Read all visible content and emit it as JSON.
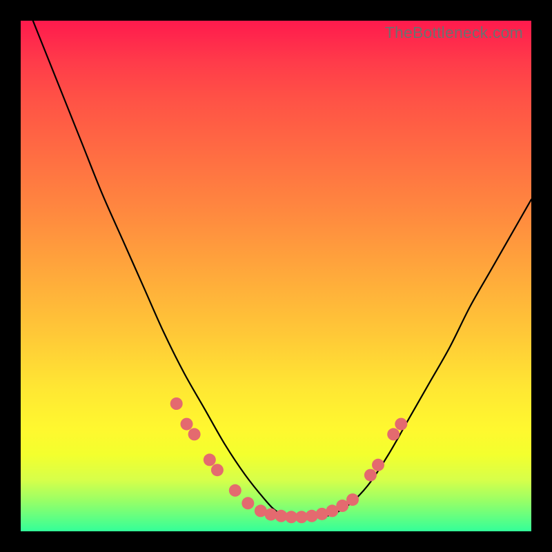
{
  "watermark": "TheBottleneck.com",
  "colors": {
    "dot": "#e46a6f",
    "curve": "#000000",
    "gradient_top": "#ff1a4d",
    "gradient_bottom": "#33ff99",
    "frame": "#000000"
  },
  "chart_data": {
    "type": "line",
    "title": "",
    "xlabel": "",
    "ylabel": "",
    "xlim": [
      0,
      100
    ],
    "ylim": [
      0,
      100
    ],
    "series": [
      {
        "name": "bottleneck-curve",
        "x": [
          0,
          4,
          8,
          12,
          16,
          20,
          24,
          28,
          32,
          36,
          40,
          44,
          48,
          50,
          52,
          56,
          60,
          64,
          68,
          72,
          76,
          80,
          84,
          88,
          92,
          96,
          100
        ],
        "y": [
          106,
          96,
          86,
          76,
          66,
          57,
          48,
          39,
          31,
          24,
          17,
          11,
          6,
          4,
          3,
          3,
          3,
          5,
          9,
          15,
          22,
          29,
          36,
          44,
          51,
          58,
          65
        ]
      }
    ],
    "markers": [
      {
        "x": 30.5,
        "y": 25.0
      },
      {
        "x": 32.5,
        "y": 21.0
      },
      {
        "x": 34.0,
        "y": 19.0
      },
      {
        "x": 37.0,
        "y": 14.0
      },
      {
        "x": 38.5,
        "y": 12.0
      },
      {
        "x": 42.0,
        "y": 8.0
      },
      {
        "x": 44.5,
        "y": 5.5
      },
      {
        "x": 47.0,
        "y": 4.0
      },
      {
        "x": 49.0,
        "y": 3.3
      },
      {
        "x": 51.0,
        "y": 3.0
      },
      {
        "x": 53.0,
        "y": 2.8
      },
      {
        "x": 55.0,
        "y": 2.8
      },
      {
        "x": 57.0,
        "y": 3.0
      },
      {
        "x": 59.0,
        "y": 3.4
      },
      {
        "x": 61.0,
        "y": 4.0
      },
      {
        "x": 63.0,
        "y": 5.0
      },
      {
        "x": 65.0,
        "y": 6.2
      },
      {
        "x": 68.5,
        "y": 11.0
      },
      {
        "x": 70.0,
        "y": 13.0
      },
      {
        "x": 73.0,
        "y": 19.0
      },
      {
        "x": 74.5,
        "y": 21.0
      }
    ],
    "marker_radius_px": 9
  }
}
